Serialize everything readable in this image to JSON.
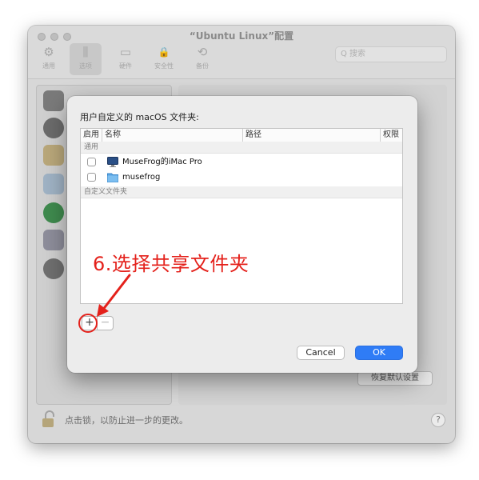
{
  "window": {
    "title": "“Ubuntu Linux”配置",
    "toolbar": [
      {
        "label": "通用",
        "icon": "gear-icon",
        "glyph": "⚙"
      },
      {
        "label": "选项",
        "icon": "sliders-icon",
        "glyph": "⫼"
      },
      {
        "label": "硬件",
        "icon": "hardware-icon",
        "glyph": "▭"
      },
      {
        "label": "安全性",
        "icon": "lock-icon",
        "glyph": "🔒"
      },
      {
        "label": "备份",
        "icon": "clock-backup-icon",
        "glyph": "⟲"
      }
    ],
    "search_placeholder": "Q 搜索",
    "restore_button": "恢复默认设置",
    "lock_text": "点击锁，以防止进一步的更改。",
    "help": "?"
  },
  "sheet": {
    "title": "用户自定义的 macOS 文件夹:",
    "columns": [
      "启用",
      "名称",
      "路径",
      "权限"
    ],
    "groups": [
      {
        "label": "通用"
      },
      {
        "label": "自定义文件夹"
      }
    ],
    "rows": [
      {
        "name": "MuseFrog的iMac Pro",
        "icon": "computer-icon",
        "enabled": false
      },
      {
        "name": "musefrog",
        "icon": "folder-icon",
        "enabled": false
      }
    ],
    "add_glyph": "+",
    "remove_glyph": "−",
    "cancel_label": "Cancel",
    "ok_label": "OK"
  },
  "annotation": {
    "text": "6.选择共享文件夹",
    "color": "#e4211b"
  },
  "colors": {
    "accent": "#2f7cf6",
    "annotation": "#e4211b"
  }
}
